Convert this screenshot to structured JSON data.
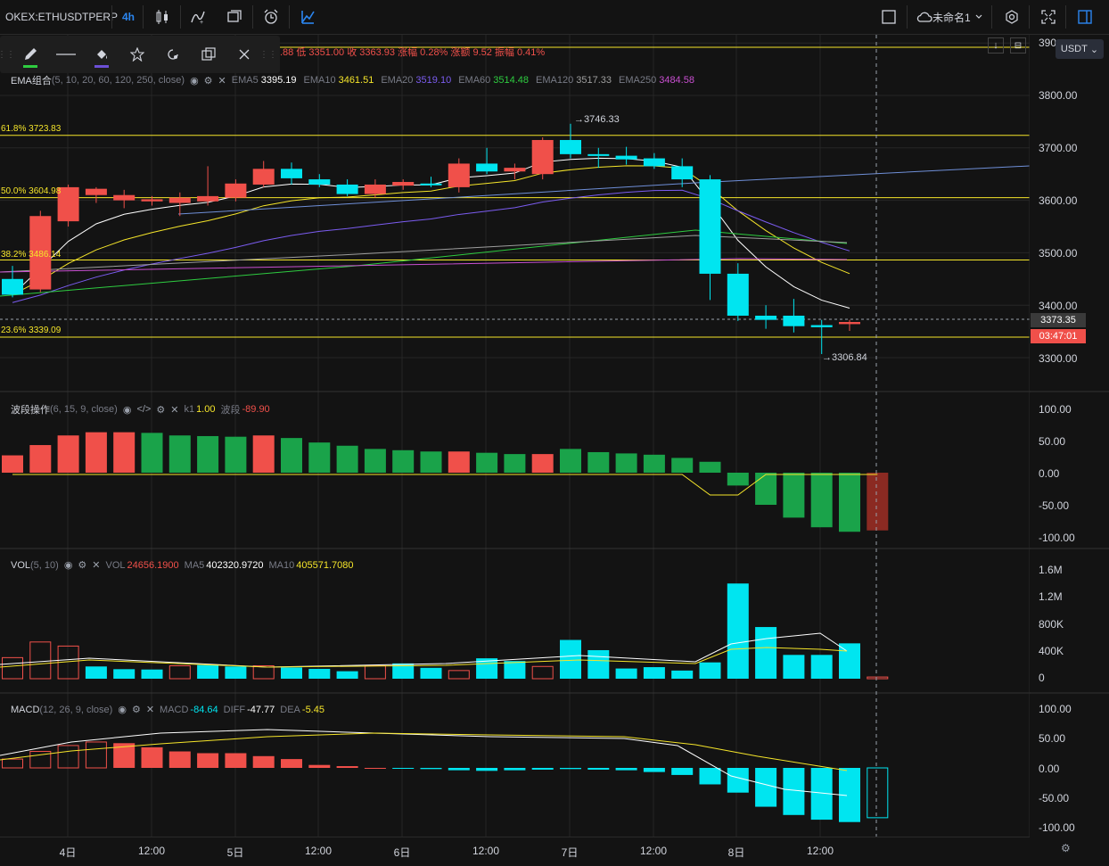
{
  "toolbar": {
    "symbol": "OKEX:ETHUSDTPERP",
    "interval": "4h",
    "layout_name": "未命名1",
    "icons": [
      "candles-icon",
      "indicators-icon",
      "compare-icon",
      "alert-icon",
      "replay-icon",
      "fullscreen-checkbox-icon",
      "cloud-icon",
      "settings-icon",
      "fullscreen-icon",
      "panel-icon"
    ]
  },
  "ohlc_header": ".88 低 3351.00 收 3363.93 涨幅 0.28% 涨额 9.52 振幅 0.41%",
  "main_legend": {
    "name": "EMA组合",
    "params": "(5, 10, 20, 60, 120, 250, close)",
    "values": [
      {
        "label": "EMA5",
        "value": "3395.19",
        "color": "#ffffff"
      },
      {
        "label": "EMA10",
        "value": "3461.51",
        "color": "#f5e52a"
      },
      {
        "label": "EMA20",
        "value": "3519.10",
        "color": "#7b5cf0"
      },
      {
        "label": "EMA60",
        "value": "3514.48",
        "color": "#2ecc40"
      },
      {
        "label": "EMA120",
        "value": "3517.33",
        "color": "#9e9e9e"
      },
      {
        "label": "EMA250",
        "value": "3484.58",
        "color": "#c84fd0"
      }
    ]
  },
  "fib_levels": [
    {
      "label": "61.8% 3723.83",
      "price": 3723.83
    },
    {
      "label": "50.0% 3604.98",
      "price": 3604.98
    },
    {
      "label": "38.2% 3486.14",
      "price": 3486.14
    },
    {
      "label": "23.6% 3339.09",
      "price": 3339.09
    }
  ],
  "price_axis": {
    "currency": "USDT",
    "top_label": "390",
    "ticks": [
      "3800.00",
      "3700.00",
      "3600.00",
      "3500.00",
      "3400.00",
      "3300.00"
    ],
    "last_price": "3373.35",
    "countdown": "03:47:01",
    "max_label": "→3746.33",
    "min_label": "→3306.84"
  },
  "wave_pane": {
    "name": "波段操作",
    "params": "(6, 15, 9, close)",
    "k1_label": "k1",
    "k1_value": "1.00",
    "wave_label": "波段",
    "wave_value": "-89.90",
    "ticks": [
      "100.00",
      "50.00",
      "0.00",
      "-50.00",
      "-100.00"
    ]
  },
  "vol_pane": {
    "name": "VOL",
    "params": "(5, 10)",
    "vol_label": "VOL",
    "vol_value": "24656.1900",
    "ma5_label": "MA5",
    "ma5_value": "402320.9720",
    "ma10_label": "MA10",
    "ma10_value": "405571.7080",
    "ticks": [
      "1.6M",
      "1.2M",
      "800K",
      "400K",
      "0"
    ]
  },
  "macd_pane": {
    "name": "MACD",
    "params": "(12, 26, 9, close)",
    "macd_label": "MACD",
    "macd_value": "-84.64",
    "diff_label": "DIFF",
    "diff_value": "-47.77",
    "dea_label": "DEA",
    "dea_value": "-5.45",
    "ticks": [
      "100.00",
      "50.00",
      "0.00",
      "-50.00",
      "-100.00"
    ]
  },
  "time_axis": [
    "4日",
    "12:00",
    "5日",
    "12:00",
    "6日",
    "12:00",
    "7日",
    "12:00",
    "8日",
    "12:00"
  ],
  "candles": [
    {
      "o": 3450,
      "h": 3475,
      "l": 3415,
      "c": 3420
    },
    {
      "o": 3430,
      "h": 3580,
      "l": 3425,
      "c": 3570
    },
    {
      "o": 3560,
      "h": 3630,
      "l": 3550,
      "c": 3625
    },
    {
      "o": 3610,
      "h": 3625,
      "l": 3595,
      "c": 3622
    },
    {
      "o": 3600,
      "h": 3620,
      "l": 3585,
      "c": 3610
    },
    {
      "o": 3598,
      "h": 3608,
      "l": 3590,
      "c": 3602
    },
    {
      "o": 3595,
      "h": 3615,
      "l": 3570,
      "c": 3605
    },
    {
      "o": 3598,
      "h": 3665,
      "l": 3590,
      "c": 3608
    },
    {
      "o": 3605,
      "h": 3640,
      "l": 3598,
      "c": 3632
    },
    {
      "o": 3630,
      "h": 3675,
      "l": 3625,
      "c": 3660
    },
    {
      "o": 3660,
      "h": 3672,
      "l": 3630,
      "c": 3642
    },
    {
      "o": 3640,
      "h": 3650,
      "l": 3625,
      "c": 3630
    },
    {
      "o": 3630,
      "h": 3640,
      "l": 3608,
      "c": 3612
    },
    {
      "o": 3612,
      "h": 3640,
      "l": 3605,
      "c": 3630
    },
    {
      "o": 3628,
      "h": 3640,
      "l": 3620,
      "c": 3635
    },
    {
      "o": 3632,
      "h": 3645,
      "l": 3625,
      "c": 3630
    },
    {
      "o": 3625,
      "h": 3680,
      "l": 3615,
      "c": 3670
    },
    {
      "o": 3670,
      "h": 3700,
      "l": 3650,
      "c": 3655
    },
    {
      "o": 3655,
      "h": 3670,
      "l": 3640,
      "c": 3662
    },
    {
      "o": 3650,
      "h": 3720,
      "l": 3640,
      "c": 3715
    },
    {
      "o": 3715,
      "h": 3746,
      "l": 3680,
      "c": 3688
    },
    {
      "o": 3688,
      "h": 3700,
      "l": 3662,
      "c": 3685
    },
    {
      "o": 3685,
      "h": 3702,
      "l": 3668,
      "c": 3678
    },
    {
      "o": 3680,
      "h": 3690,
      "l": 3660,
      "c": 3665
    },
    {
      "o": 3665,
      "h": 3680,
      "l": 3625,
      "c": 3640
    },
    {
      "o": 3640,
      "h": 3648,
      "l": 3410,
      "c": 3460
    },
    {
      "o": 3460,
      "h": 3480,
      "l": 3370,
      "c": 3380
    },
    {
      "o": 3380,
      "h": 3400,
      "l": 3355,
      "c": 3372
    },
    {
      "o": 3380,
      "h": 3412,
      "l": 3348,
      "c": 3360
    },
    {
      "o": 3362,
      "h": 3372,
      "l": 3306.84,
      "c": 3358
    },
    {
      "o": 3368,
      "h": 3372,
      "l": 3351,
      "c": 3363.93,
      "down": true
    }
  ],
  "wave_values": [
    27,
    43,
    58,
    63,
    63,
    62,
    58,
    57,
    56,
    58,
    54,
    47,
    42,
    37,
    35,
    33,
    33,
    31,
    29,
    29,
    37,
    32,
    30,
    28,
    23,
    17,
    -20,
    -50,
    -70,
    -85,
    -92,
    -89.9
  ],
  "vol_values": [
    310,
    540,
    480,
    180,
    140,
    135,
    190,
    200,
    180,
    190,
    165,
    145,
    110,
    190,
    225,
    160,
    120,
    300,
    260,
    180,
    570,
    420,
    150,
    170,
    120,
    240,
    1400,
    760,
    350,
    350,
    520,
    25
  ],
  "macd_values": [
    15,
    28,
    38,
    44,
    42,
    35,
    28,
    25,
    25,
    20,
    15,
    5,
    3,
    0,
    -1,
    -2,
    -4,
    -5,
    -4,
    -3,
    -2,
    -3,
    -4,
    -7,
    -12,
    -28,
    -42,
    -66,
    -80,
    -88,
    -92,
    -84.64
  ]
}
